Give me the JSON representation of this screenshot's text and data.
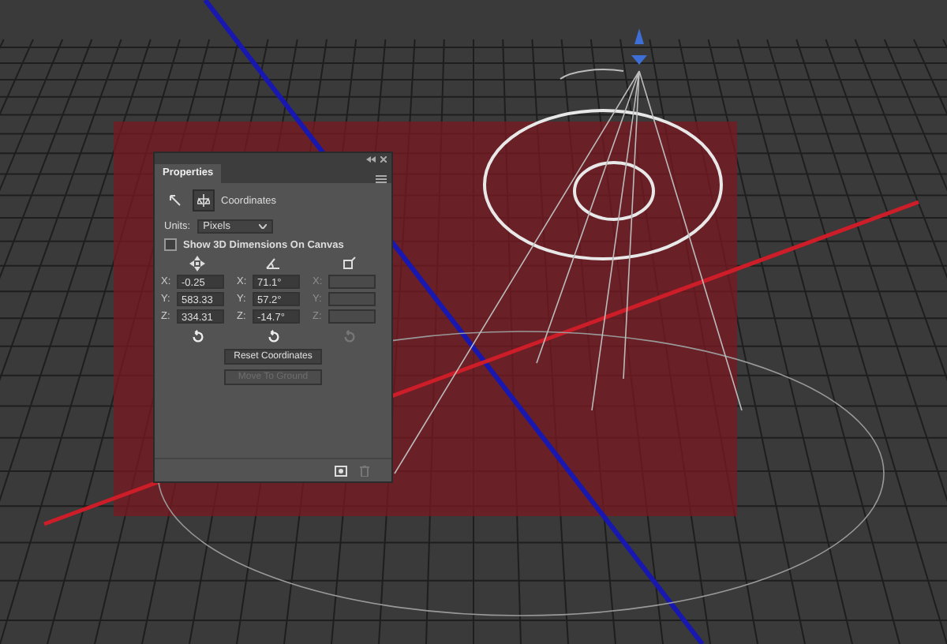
{
  "panel": {
    "title": "Properties",
    "section": "Coordinates",
    "units_label": "Units:",
    "units_value": "Pixels",
    "show_dimensions": {
      "label": "Show 3D Dimensions On Canvas",
      "checked": false
    },
    "columns": [
      {
        "kind": "position",
        "disabled": false,
        "fields": [
          {
            "label": "X:",
            "value": "-0.25"
          },
          {
            "label": "Y:",
            "value": "583.33"
          },
          {
            "label": "Z:",
            "value": "334.31"
          }
        ]
      },
      {
        "kind": "rotation",
        "disabled": false,
        "fields": [
          {
            "label": "X:",
            "value": "71.1°"
          },
          {
            "label": "Y:",
            "value": "57.2°"
          },
          {
            "label": "Z:",
            "value": "-14.7°"
          }
        ]
      },
      {
        "kind": "scale",
        "disabled": true,
        "fields": [
          {
            "label": "X:"
          },
          {
            "label": "Y:"
          },
          {
            "label": "Z:"
          }
        ]
      }
    ],
    "buttons": [
      {
        "label": "Reset Coordinates",
        "disabled": false
      },
      {
        "label": "Move To Ground",
        "disabled": true
      }
    ]
  }
}
